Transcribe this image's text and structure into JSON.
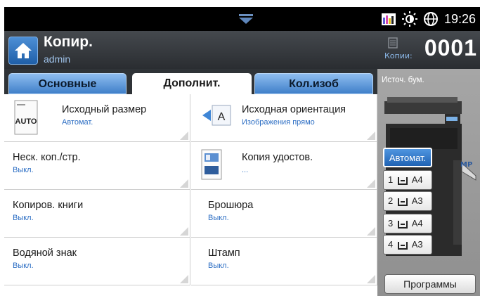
{
  "status_bar": {
    "time": "19:26",
    "icons": [
      "pull-down-icon",
      "toner-levels-icon",
      "eco-brightness-icon",
      "globe-icon"
    ]
  },
  "title_bar": {
    "title": "Копир.",
    "user": "admin",
    "copies_label": "Копии:",
    "copies_count": "0001"
  },
  "tabs": [
    {
      "label": "Основные",
      "active": false
    },
    {
      "label": "Дополнит.",
      "active": true
    },
    {
      "label": "Кол.изоб",
      "active": false
    }
  ],
  "options": [
    {
      "label": "Исходный размер",
      "value": "Автомат.",
      "icon": "auto-size-icon",
      "icon_text": "AUTO"
    },
    {
      "label": "Исходная ориентация",
      "value": "Изображения прямо",
      "icon": "orientation-icon",
      "icon_text": "A"
    },
    {
      "label": "Неск. коп./стр.",
      "value": "Выкл."
    },
    {
      "label": "Копия удостов.",
      "value": "...",
      "icon": "id-card-copy-icon"
    },
    {
      "label": "Копиров. книги",
      "value": "Выкл."
    },
    {
      "label": "Брошюра",
      "value": "Выкл."
    },
    {
      "label": "Водяной знак",
      "value": "Выкл."
    },
    {
      "label": "Штамп",
      "value": "Выкл."
    }
  ],
  "paper_source": {
    "label": "Источ. бум.",
    "mp_label": "MP",
    "trays": [
      {
        "label": "Автомат.",
        "selected": true
      },
      {
        "label": "1",
        "size": "A4",
        "selected": false
      },
      {
        "label": "2",
        "size": "A3",
        "selected": false
      },
      {
        "label": "3",
        "size": "A4",
        "selected": false
      },
      {
        "label": "4",
        "size": "A3",
        "selected": false
      }
    ]
  },
  "programs_button": "Программы",
  "colors": {
    "accent": "#2e6fc4",
    "tab_blue": "#3f7fc9",
    "titlebar": "#2a2d31",
    "panel_gray": "#9a9a9a"
  }
}
